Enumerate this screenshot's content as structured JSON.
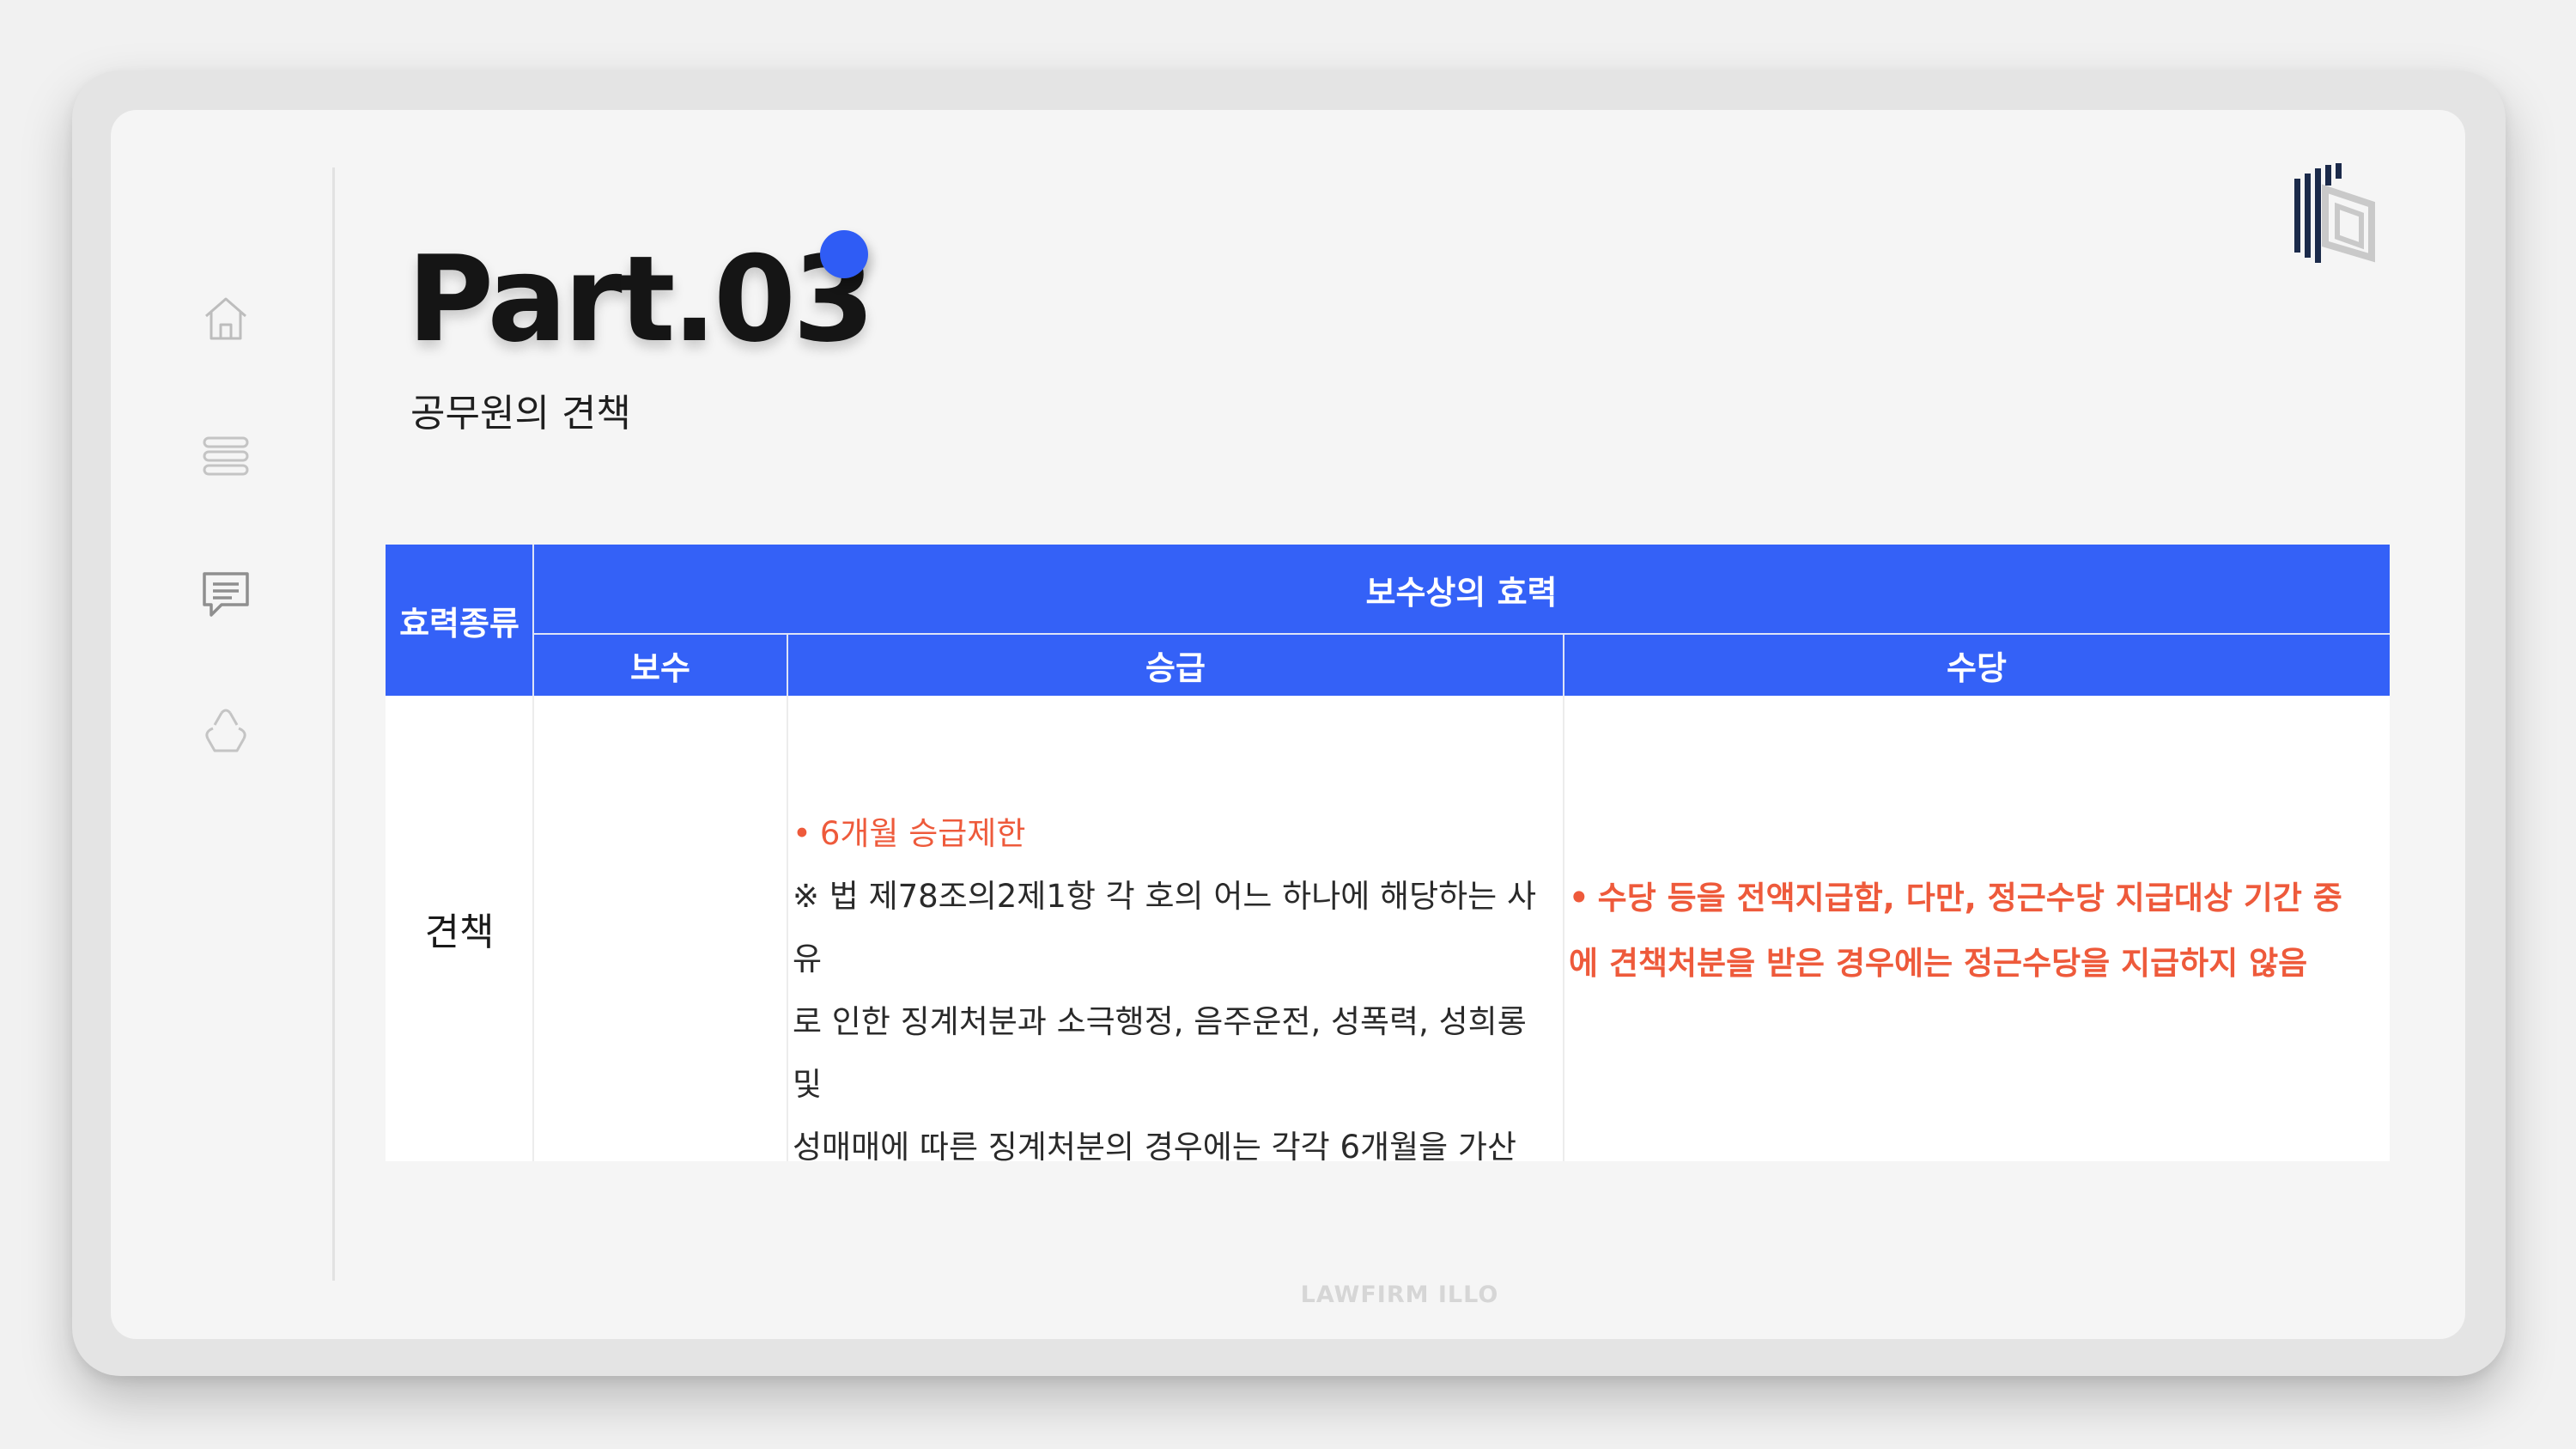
{
  "slide": {
    "title": "Part.03",
    "subtitle": "공무원의 견책",
    "footer": "LAWFIRM ILLO"
  },
  "sidebar": {
    "items": [
      {
        "icon": "home-icon"
      },
      {
        "icon": "list-icon"
      },
      {
        "icon": "chat-icon"
      },
      {
        "icon": "recycle-icon"
      }
    ]
  },
  "table": {
    "header": {
      "type_label": "효력종류",
      "group_label": "보수상의 효력",
      "columns": [
        "보수",
        "승급",
        "수당"
      ]
    },
    "row": {
      "label": "견책",
      "pay": "",
      "promotion": {
        "bullet": "6개월 승급제한",
        "note_lines": [
          "※ 법 제78조의2제1항 각 호의 어느 하나에 해당하는 사유",
          "로 인한 징계처분과 소극행정, 음주운전, 성폭력, 성희롱 및",
          "성매매에 따른 징계처분의 경우에는 각각 6개월을 가산"
        ]
      },
      "allowance": {
        "lines": [
          "수당 등을 전액지급함, 다만, 정근수당 지급대상 기간 중",
          "에 견책처분을 받은 경우에는 정근수당을 지급하지 않음"
        ]
      }
    }
  },
  "colors": {
    "accent": "#2f5cf5",
    "header_bg": "#3461f7",
    "highlight": "#ee5a3b"
  }
}
